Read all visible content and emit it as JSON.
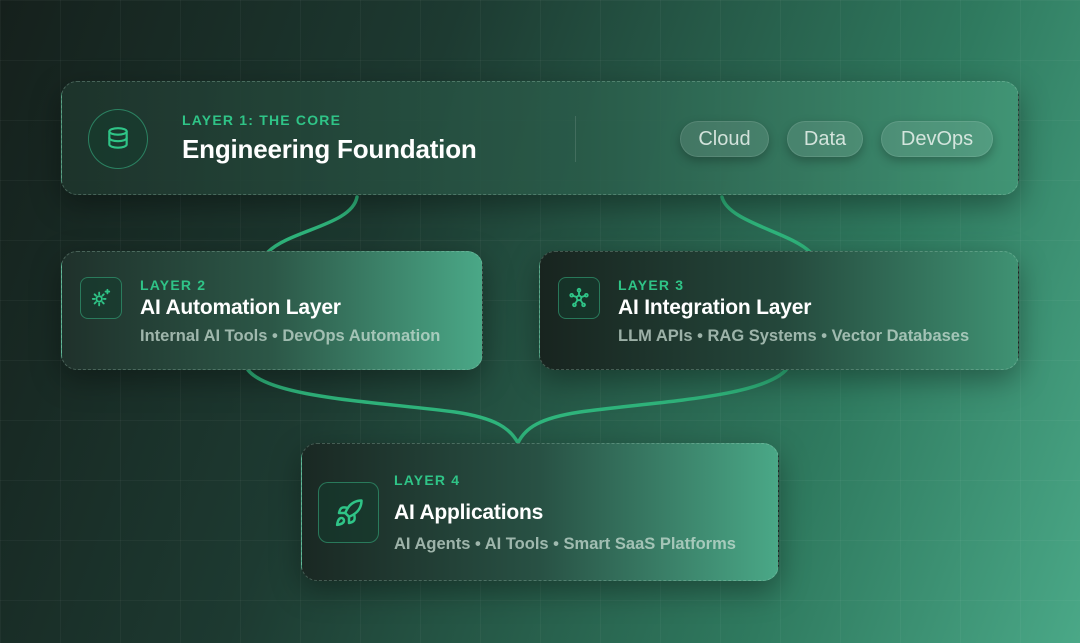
{
  "colors": {
    "accent": "#2fc487",
    "connector": "#2fb57c",
    "title": "#ffffff"
  },
  "layer1": {
    "eyebrow": "LAYER 1: THE CORE",
    "title": "Engineering Foundation",
    "icon": "database-icon",
    "chips": [
      "Cloud",
      "Data",
      "DevOps"
    ]
  },
  "layer2": {
    "eyebrow": "LAYER 2",
    "title": "AI Automation Layer",
    "subtitle": "Internal AI Tools • DevOps Automation",
    "icon": "gear-sparkle-icon"
  },
  "layer3": {
    "eyebrow": "LAYER 3",
    "title": "AI Integration Layer",
    "subtitle": "LLM APIs • RAG Systems • Vector Databases",
    "icon": "network-hub-icon"
  },
  "layer4": {
    "eyebrow": "LAYER 4",
    "title": "AI Applications",
    "subtitle": "AI Agents • AI Tools • Smart SaaS Platforms",
    "icon": "rocket-icon"
  }
}
